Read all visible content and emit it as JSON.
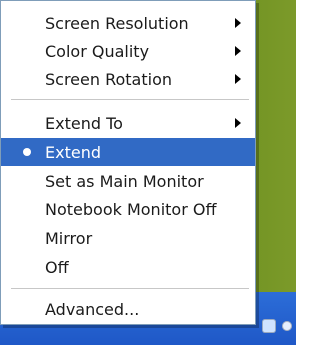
{
  "menu": {
    "items": [
      {
        "label": "Screen Resolution",
        "has_submenu": true
      },
      {
        "label": "Color Quality",
        "has_submenu": true
      },
      {
        "label": "Screen Rotation",
        "has_submenu": true
      },
      {
        "label": "Extend To",
        "has_submenu": true
      },
      {
        "label": "Extend",
        "selected": true,
        "bullet": true
      },
      {
        "label": "Set as Main Monitor"
      },
      {
        "label": "Notebook Monitor Off"
      },
      {
        "label": "Mirror"
      },
      {
        "label": "Off"
      },
      {
        "label": "Advanced..."
      }
    ]
  },
  "colors": {
    "menu_bg": "#ffffff",
    "menu_border": "#7f9db9",
    "selected_bg": "#316ac5",
    "taskbar": "#2c6dd8"
  }
}
